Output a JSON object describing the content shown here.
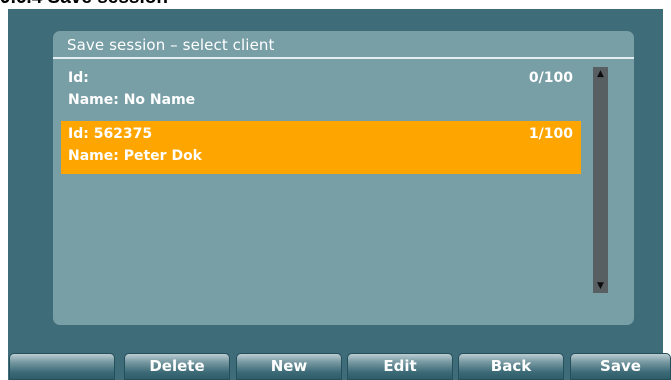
{
  "doc_heading": "9.6.4 Save session",
  "dialog": {
    "title": "Save session – select client",
    "clients": [
      {
        "id_text": "Id:",
        "name_text": "Name: No Name",
        "count": "0/100",
        "selected": false
      },
      {
        "id_text": "Id: 562375",
        "name_text": "Name: Peter Dok",
        "count": "1/100",
        "selected": true
      }
    ]
  },
  "scrollbar": {
    "up_icon": "arrow-up",
    "down_icon": "arrow-down"
  },
  "softkeys": {
    "blank": "",
    "delete": "Delete",
    "new": "New",
    "edit": "Edit",
    "back": "Back",
    "save": "Save"
  },
  "colors": {
    "screen_bg": "#3e6c78",
    "dialog_bg": "#789ea6",
    "selection": "#ffa500",
    "scrollbar": "#585f62"
  }
}
